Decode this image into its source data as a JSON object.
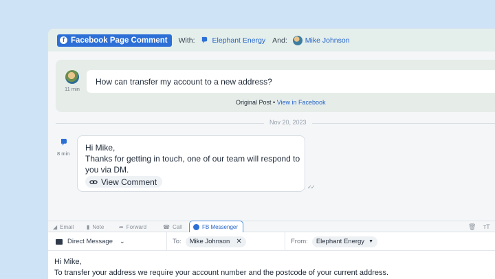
{
  "header": {
    "channel_label": "Facebook Page Comment",
    "with_label": "With:",
    "with_value": "Elephant Energy",
    "and_label": "And:",
    "and_value": "Mike Johnson"
  },
  "post": {
    "time": "11 min",
    "text": "How can transfer my account to a new address?",
    "original_label": "Original Post",
    "separator": " • ",
    "view_link": "View in Facebook"
  },
  "date_separator": "Nov 20, 2023",
  "reply": {
    "time": "8 min",
    "line1": "Hi Mike,",
    "line2": "Thanks for getting in touch, one of our team will respond to",
    "line3": "you via DM.",
    "view_comment": "View Comment",
    "status": "✓✓"
  },
  "composer": {
    "tabs": [
      {
        "label": "Email",
        "icon": "send-icon"
      },
      {
        "label": "Note",
        "icon": "note-icon"
      },
      {
        "label": "Forward",
        "icon": "forward-icon"
      },
      {
        "label": "Call",
        "icon": "phone-icon"
      },
      {
        "label": "FB Messenger",
        "icon": "messenger-icon",
        "active": true
      }
    ],
    "type_label": "Direct Message",
    "to_label": "To:",
    "to_value": "Mike Johnson",
    "from_label": "From:",
    "from_value": "Elephant Energy",
    "draft_line1": "Hi Mike,",
    "draft_line2": "To transfer your address we require your account number and the postcode of your current address."
  },
  "colors": {
    "background": "#cfe3f7",
    "accent": "#2c6fd6",
    "link": "#2563c9"
  }
}
